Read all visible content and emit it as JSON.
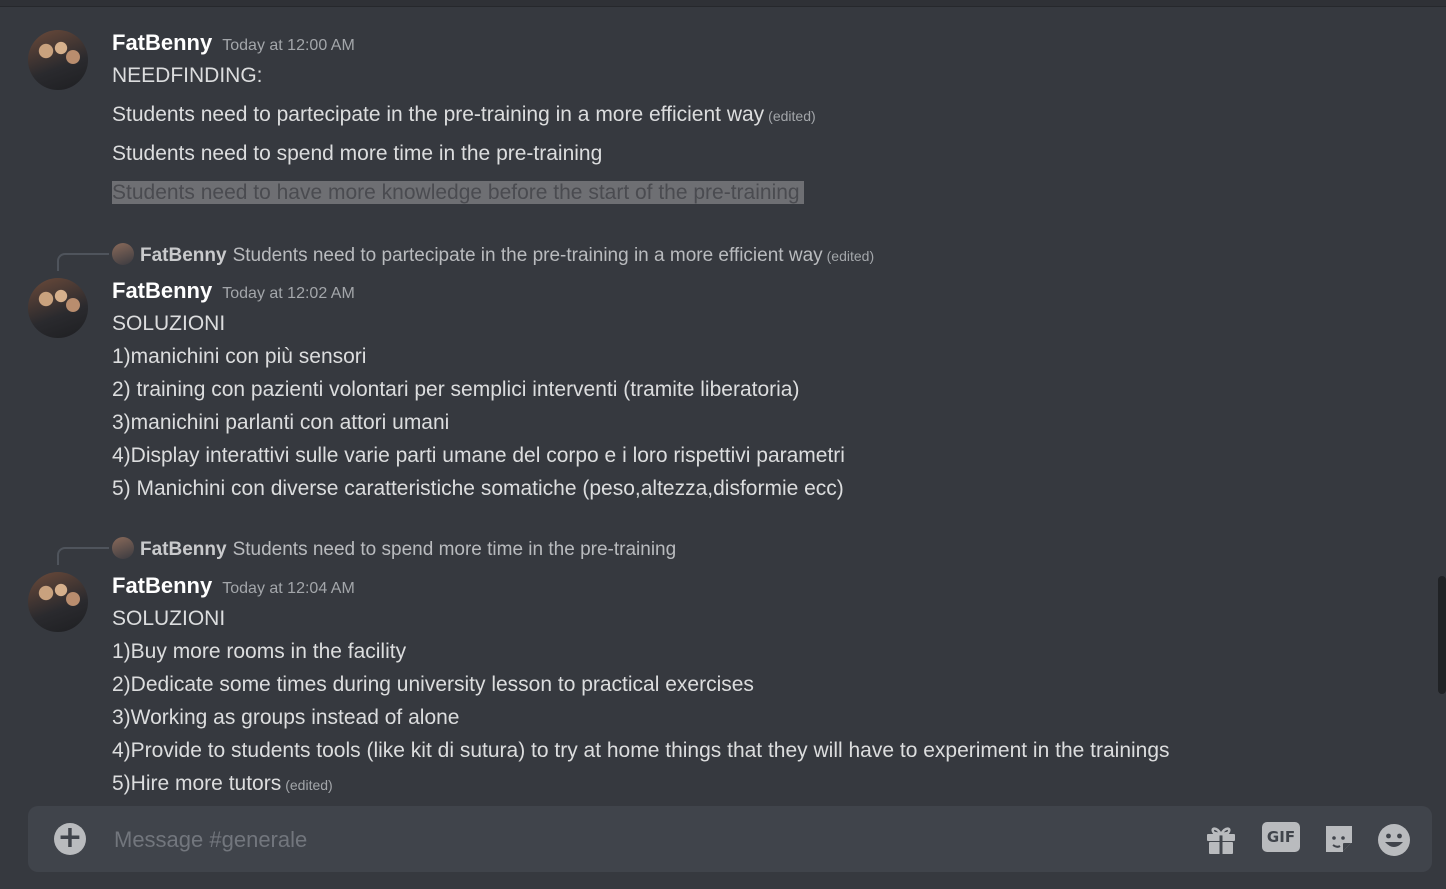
{
  "channel": {
    "placeholder": "Message #generale"
  },
  "messages": [
    {
      "user": "FatBenny",
      "timestamp": "Today at 12:00 AM",
      "lines": [
        {
          "text": "NEEDFINDING:"
        },
        {
          "text": "Students need to partecipate in the pre-training in a more efficient way",
          "edited": "(edited)"
        },
        {
          "text": "Students need to spend more time in the pre-training"
        },
        {
          "text": "Students need to have more knowledge before the start of the pre-training",
          "selected": true
        }
      ]
    },
    {
      "reply": {
        "user": "FatBenny",
        "text": "Students need to partecipate in the pre-training in a more efficient way",
        "edited": "(edited)"
      },
      "user": "FatBenny",
      "timestamp": "Today at 12:02 AM",
      "lines": [
        {
          "text": "SOLUZIONI"
        },
        {
          "text": "1)manichini con più sensori"
        },
        {
          "text": "2) training con pazienti volontari per semplici interventi (tramite liberatoria)"
        },
        {
          "text": "3)manichini parlanti con attori umani"
        },
        {
          "text": "4)Display interattivi sulle varie parti umane del corpo e i loro rispettivi parametri"
        },
        {
          "text": "5) Manichini con diverse caratteristiche somatiche (peso,altezza,disformie ecc)"
        }
      ]
    },
    {
      "reply": {
        "user": "FatBenny",
        "text": "Students need to spend more time in the pre-training"
      },
      "user": "FatBenny",
      "timestamp": "Today at 12:04 AM",
      "lines": [
        {
          "text": "SOLUZIONI"
        },
        {
          "text": "1)Buy more rooms in the facility"
        },
        {
          "text": "2)Dedicate some times during university lesson to practical exercises"
        },
        {
          "text": "3)Working as groups instead of alone"
        },
        {
          "text": "4)Provide to students tools (like kit di sutura) to try at home things that they will have to experiment in the trainings"
        },
        {
          "text": "5)Hire more tutors",
          "edited": "(edited)"
        }
      ]
    }
  ],
  "composer_icons": [
    "plus-circle-icon",
    "gift-icon",
    "gif-icon",
    "sticker-icon",
    "emoji-icon"
  ],
  "composer_gif_label": "GIF",
  "composer_plus_glyph": "+"
}
